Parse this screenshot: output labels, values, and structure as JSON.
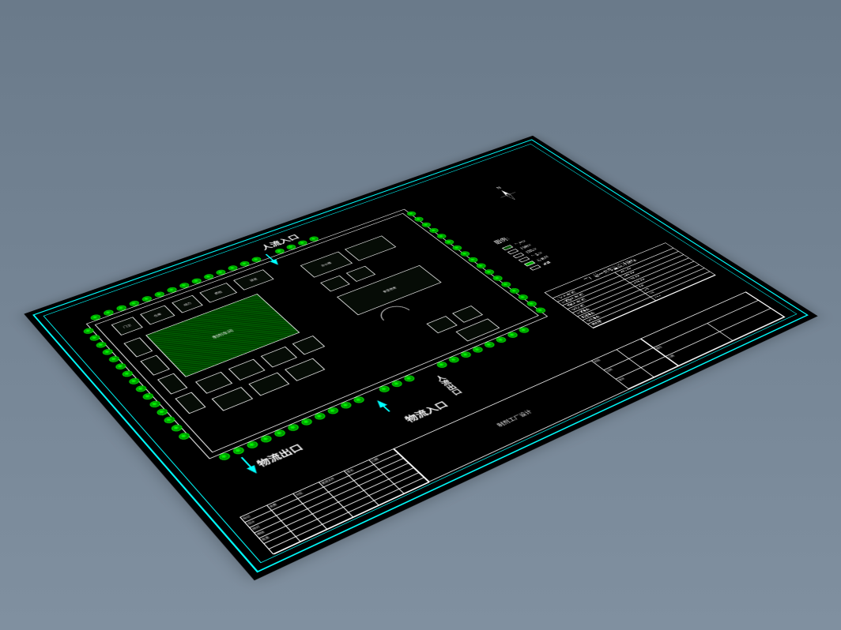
{
  "gates": {
    "people_in": "人流入口",
    "people_out": "人流出口",
    "logistics_in": "物流入口",
    "logistics_out": "物流出口"
  },
  "buildings": {
    "main_workshop": "制剂车间",
    "office": "办公楼",
    "dining": "食堂宿舍",
    "b1": "门卫",
    "b2": "仓库",
    "b3": "动力",
    "b4": "质检",
    "b5": "研发"
  },
  "legend": {
    "title": "图例:",
    "items": [
      "生产区",
      "辅助区",
      "行政区",
      "生活区",
      "绿化带",
      "道路"
    ]
  },
  "compass_n": "N",
  "spec_table": {
    "title": "工厂总平面布置设计指标",
    "rows": [
      [
        "厂区占地面积",
        "15000 m²"
      ],
      [
        "建筑物占地面积",
        "6800 m²"
      ],
      [
        "道路占地面积",
        "2400 m²"
      ],
      [
        "绿化面积",
        "3200 m²"
      ],
      [
        "建筑系数",
        "45%"
      ],
      [
        "利用系数",
        "62%"
      ],
      [
        "绿化系数",
        "21%"
      ],
      [
        "容积率",
        "0.85"
      ]
    ]
  },
  "title_block": {
    "rev_headers": [
      "标记",
      "处数",
      "分区",
      "更改文件",
      "签名",
      "日期"
    ],
    "labels": [
      "设计",
      "校对",
      "审核",
      "批准"
    ],
    "project": "制剂工厂设计",
    "approval_h": [
      "阶段",
      "比例",
      "张次"
    ],
    "info": [
      "图号",
      "日期"
    ]
  }
}
